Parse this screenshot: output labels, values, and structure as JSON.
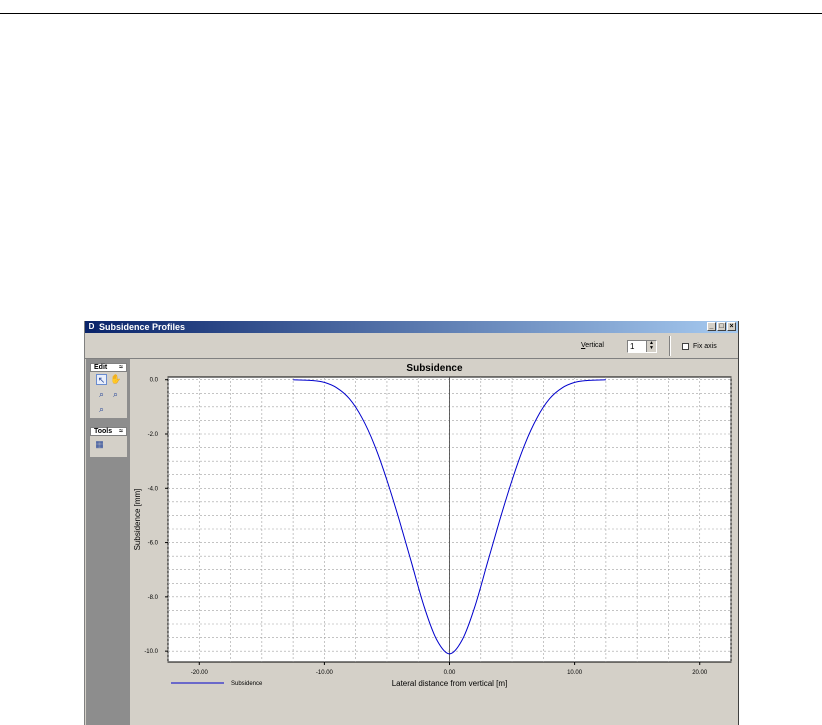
{
  "window": {
    "title": "Subsidence Profiles",
    "icon_letter": "D",
    "buttons": [
      "_",
      "□",
      "×"
    ]
  },
  "toolbar": {
    "vertical_label_prefix": "V",
    "vertical_label_rest": "ertical",
    "vertical_value": "1",
    "fix_axis_label": "Fix axis",
    "fix_axis_checked": false
  },
  "panel": {
    "edit_title": "Edit",
    "tools_title": "Tools",
    "collapse_glyph": "≈"
  },
  "chart_data": {
    "type": "line",
    "title": "Subsidence",
    "xlabel": "Lateral distance from vertical [m]",
    "ylabel": "Subsidence [mm]",
    "xlim": [
      -22.5,
      22.5
    ],
    "ylim": [
      -10.4,
      0.1
    ],
    "x_ticks": [
      "-20.00",
      "-10.00",
      "0.00",
      "10.00",
      "20.00"
    ],
    "y_ticks": [
      "0.0",
      "-2.0",
      "-4.0",
      "-6.0",
      "-8.0",
      "-10.0"
    ],
    "grid": true,
    "legend_position": "bottom-left",
    "series": [
      {
        "name": "Subsidence",
        "color": "#0000cc",
        "x": [
          -12.5,
          -11,
          -10,
          -9,
          -8,
          -7,
          -6,
          -5,
          -4,
          -3,
          -2,
          -1,
          0,
          1,
          2,
          3,
          4,
          5,
          6,
          7,
          8,
          9,
          10,
          11,
          12.5
        ],
        "y": [
          0.0,
          -0.03,
          -0.1,
          -0.3,
          -0.7,
          -1.4,
          -2.4,
          -3.7,
          -5.2,
          -6.8,
          -8.4,
          -9.6,
          -10.1,
          -9.6,
          -8.4,
          -6.8,
          -5.2,
          -3.7,
          -2.4,
          -1.4,
          -0.7,
          -0.3,
          -0.1,
          -0.03,
          0.0
        ]
      }
    ]
  }
}
